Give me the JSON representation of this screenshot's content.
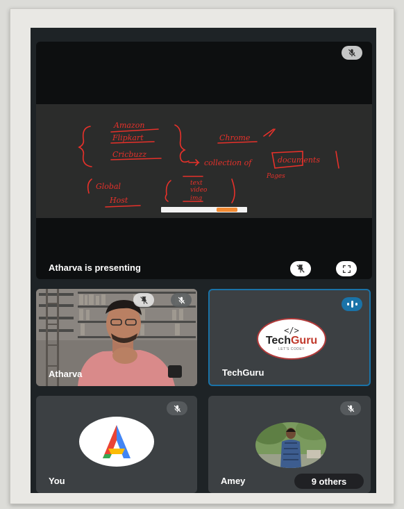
{
  "presentation": {
    "label": "Atharva is presenting",
    "slide_lines": {
      "list": [
        "Amazon",
        "Flipkart",
        "Cricbuzz"
      ],
      "right_top": "Chrome",
      "collection": "collection of",
      "documents": "documents",
      "pages": "Pages",
      "global": "Global",
      "host": "Host",
      "media": [
        "text",
        "video",
        "img"
      ]
    }
  },
  "participants": [
    {
      "name": "Atharva",
      "type": "video"
    },
    {
      "name": "TechGuru",
      "type": "logo",
      "logo_code": "</>",
      "logo_word_a": "Tech",
      "logo_word_b": "Guru",
      "logo_tagline": "LET'S CODE!!"
    },
    {
      "name": "You",
      "type": "avatar-letter",
      "letter": "A"
    },
    {
      "name": "Amey",
      "type": "photo"
    }
  ],
  "others_label": "9 others",
  "colors": {
    "tile": "#3c4043",
    "speaking": "#1a73a8",
    "ink": "#e8312a"
  },
  "icons": {
    "muted": "mic-off-icon",
    "pin_off": "pin-off-icon",
    "fullscreen": "fullscreen-icon",
    "speaking": "audio-level-icon"
  }
}
